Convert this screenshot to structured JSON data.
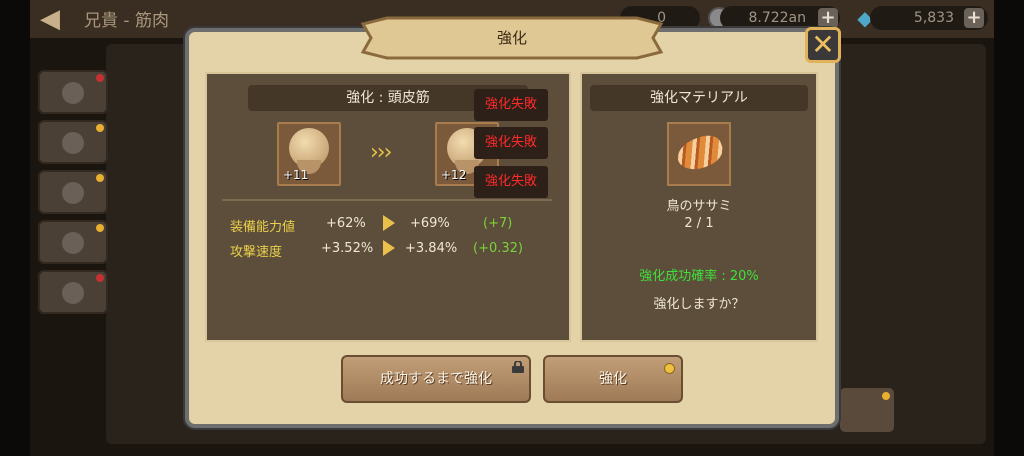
{
  "header": {
    "title": "兄貴 - 筋肉",
    "currency1": "0",
    "currency2": "8.722an",
    "gems": "5,833"
  },
  "modal": {
    "title": "強化",
    "close_icon": "close-x-icon",
    "left": {
      "heading": "強化 : 頭皮筋",
      "from_level": "+11",
      "to_level": "+12",
      "fail_messages": [
        "強化失敗",
        "強化失敗",
        "強化失敗"
      ],
      "stats": [
        {
          "label": "装備能力値",
          "from": "+62%",
          "to": "+69%",
          "delta": "(+7)"
        },
        {
          "label": "攻撃速度",
          "from": "+3.52%",
          "to": "+3.84%",
          "delta": "(+0.32)"
        }
      ]
    },
    "right": {
      "heading": "強化マテリアル",
      "material_name": "鳥のササミ",
      "material_count": "2 / 1",
      "success_rate": "強化成功確率 : 20%",
      "confirm_text": "強化しますか？"
    },
    "buttons": {
      "auto": "成功するまで強化",
      "enhance": "強化"
    }
  },
  "colors": {
    "fail": "#ff2a2a",
    "delta": "#7ad23a",
    "success_rate": "#3ee03a",
    "stat_label": "#e8d04a"
  }
}
